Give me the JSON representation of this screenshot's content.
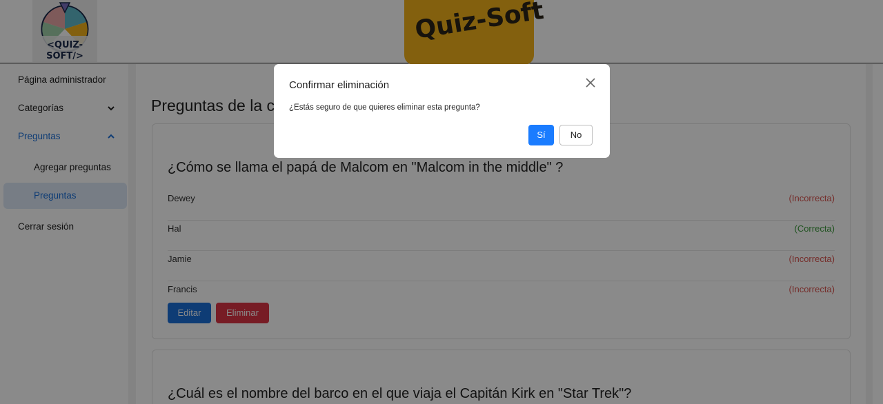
{
  "header": {
    "logo_text": "<QUIZ-SOFT/>",
    "brand": "Quiz-Soft"
  },
  "sidebar": {
    "items": [
      {
        "label": "Página administrador"
      },
      {
        "label": "Categorías",
        "chevron": "chevron-down-icon"
      },
      {
        "label": "Preguntas",
        "chevron": "chevron-up-icon"
      },
      {
        "label": "Agregar preguntas"
      },
      {
        "label": "Preguntas"
      },
      {
        "label": "Cerrar sesión"
      }
    ]
  },
  "main": {
    "title": "Preguntas de la c",
    "questions": [
      {
        "text": "¿Cómo se llama el papá de Malcom en \"Malcom in the middle\" ?",
        "options": [
          {
            "text": "Dewey",
            "result": "(Incorrecta)"
          },
          {
            "text": "Hal",
            "result": "(Correcta)"
          },
          {
            "text": "Jamie",
            "result": "(Incorrecta)"
          },
          {
            "text": "Francis",
            "result": "(Incorrecta)"
          }
        ],
        "edit_label": "Editar",
        "delete_label": "Eliminar"
      },
      {
        "text": "¿Cuál es el nombre del barco en el que viaja el Capitán Kirk en \"Star Trek\"?"
      }
    ]
  },
  "modal": {
    "title": "Confirmar eliminación",
    "body": "¿Estás seguro de que quieres eliminar esta pregunta?",
    "yes_label": "Sí",
    "no_label": "No",
    "close_icon": "close-icon"
  },
  "colors": {
    "brand": "#f2b21a",
    "primary": "#1a6fd8",
    "danger": "#dc3545",
    "success": "#3c9a3c"
  }
}
